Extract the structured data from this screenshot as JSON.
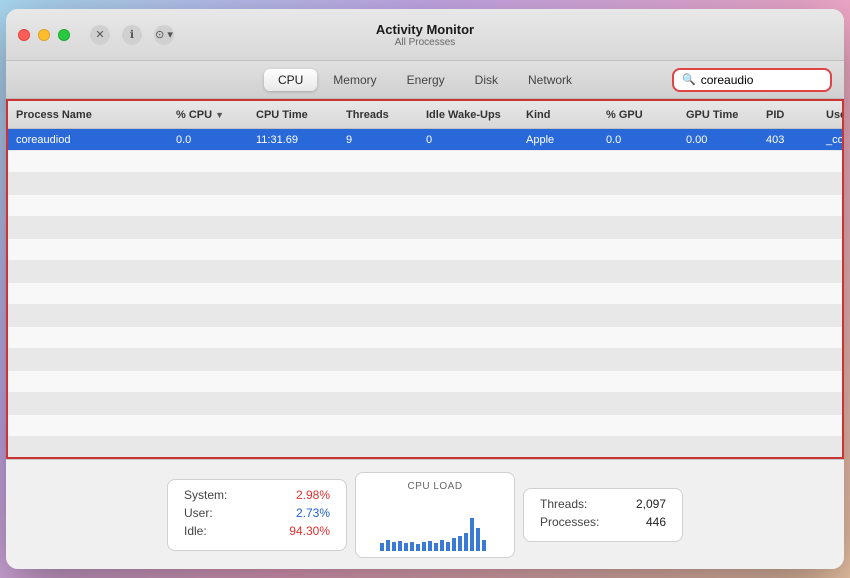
{
  "window": {
    "title": "Activity Monitor",
    "subtitle": "All Processes"
  },
  "traffic_lights": {
    "close_label": "close",
    "minimize_label": "minimize",
    "maximize_label": "maximize"
  },
  "toolbar": {
    "action_close_label": "✕",
    "action_info_label": "ℹ",
    "action_more_label": "⊕",
    "tabs": [
      {
        "id": "cpu",
        "label": "CPU",
        "active": true
      },
      {
        "id": "memory",
        "label": "Memory",
        "active": false
      },
      {
        "id": "energy",
        "label": "Energy",
        "active": false
      },
      {
        "id": "disk",
        "label": "Disk",
        "active": false
      },
      {
        "id": "network",
        "label": "Network",
        "active": false
      }
    ],
    "search_placeholder": "coreaudio",
    "search_value": "coreaudio"
  },
  "table": {
    "columns": [
      {
        "id": "process-name",
        "label": "Process Name",
        "sorted": false
      },
      {
        "id": "cpu",
        "label": "% CPU",
        "sorted": true
      },
      {
        "id": "cpu-time",
        "label": "CPU Time",
        "sorted": false
      },
      {
        "id": "threads",
        "label": "Threads",
        "sorted": false
      },
      {
        "id": "idle-wakeups",
        "label": "Idle Wake-Ups",
        "sorted": false
      },
      {
        "id": "kind",
        "label": "Kind",
        "sorted": false
      },
      {
        "id": "gpu",
        "label": "% GPU",
        "sorted": false
      },
      {
        "id": "gpu-time",
        "label": "GPU Time",
        "sorted": false
      },
      {
        "id": "pid",
        "label": "PID",
        "sorted": false
      },
      {
        "id": "user",
        "label": "User",
        "sorted": false
      }
    ],
    "rows": [
      {
        "id": 1,
        "selected": true,
        "process_name": "coreaudiod",
        "cpu": "0.0",
        "cpu_time": "11:31.69",
        "threads": "9",
        "idle_wakeups": "0",
        "kind": "Apple",
        "gpu": "0.0",
        "gpu_time": "0.00",
        "pid": "403",
        "user": "_coreaudiod"
      }
    ],
    "empty_rows": 18
  },
  "bottom": {
    "system_label": "System:",
    "system_value": "2.98%",
    "user_label": "User:",
    "user_value": "2.73%",
    "idle_label": "Idle:",
    "idle_value": "94.30%",
    "cpu_load_title": "CPU LOAD",
    "threads_label": "Threads:",
    "threads_value": "2,097",
    "processes_label": "Processes:",
    "processes_value": "446"
  }
}
